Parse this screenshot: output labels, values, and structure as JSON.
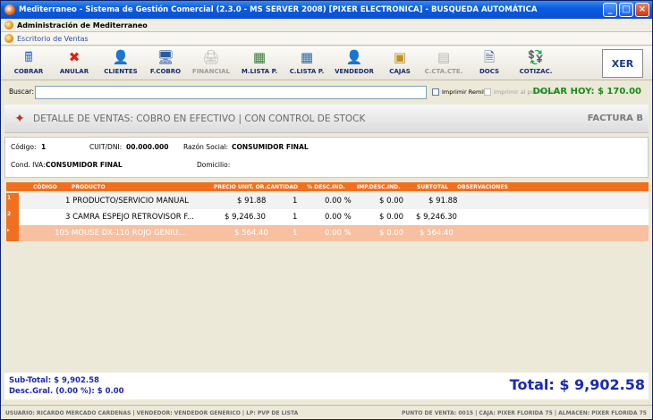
{
  "window": {
    "title": "Mediterraneo - Sistema de Gestión Comercial (2.3.0 - MS SERVER 2008) [PIXER ELECTRONICA] - BUSQUEDA AUTOMÁTICA",
    "btn_min": "_",
    "btn_max": "□",
    "btn_close": "×"
  },
  "menubar": {
    "admin": "Administración de Mediterraneo",
    "desk": "Escritorio de Ventas"
  },
  "toolbar": {
    "items": [
      {
        "label": "COBRAR",
        "icon": "cash-register-icon",
        "glyph": "🖩",
        "color": "#2a6ac0",
        "disabled": false
      },
      {
        "label": "ANULAR",
        "icon": "cancel-x-icon",
        "glyph": "✖",
        "color": "#e02010",
        "disabled": false
      },
      {
        "label": "CLIENTES",
        "icon": "person-icon",
        "glyph": "👤",
        "color": "#c06020",
        "disabled": false
      },
      {
        "label": "F.COBRO",
        "icon": "monitor-person-icon",
        "glyph": "🖥",
        "color": "#2a5aa0",
        "disabled": false
      },
      {
        "label": "FINANCIAL",
        "icon": "printer-icon",
        "glyph": "🖨",
        "color": "#707070",
        "disabled": true
      },
      {
        "label": "M.LISTA P.",
        "icon": "grid-list-icon",
        "glyph": "▦",
        "color": "#3a7a3a",
        "disabled": false
      },
      {
        "label": "C.LISTA P.",
        "icon": "grid-search-icon",
        "glyph": "▦",
        "color": "#2a6aa0",
        "disabled": false
      },
      {
        "label": "VENDEDOR",
        "icon": "salesman-icon",
        "glyph": "👤",
        "color": "#d08020",
        "disabled": false
      },
      {
        "label": "CAJAS",
        "icon": "boxes-icon",
        "glyph": "▣",
        "color": "#c09020",
        "disabled": false
      },
      {
        "label": "C.CTA.CTE.",
        "icon": "account-icon",
        "glyph": "▤",
        "color": "#707070",
        "disabled": true
      },
      {
        "label": "DOCS",
        "icon": "document-icon",
        "glyph": "🗎",
        "color": "#4a6a9a",
        "disabled": false
      },
      {
        "label": "COTIZAC.",
        "icon": "money-icon",
        "glyph": "💱",
        "color": "#3a9a3a",
        "disabled": false
      }
    ],
    "logo": "XER"
  },
  "search": {
    "label": "Buscar:",
    "value": "",
    "imprimir_remito": "Imprimir Remito",
    "imprimir_mayor": "Imprimir al por Mayor",
    "dolar": "DOLAR HOY: $ 170.00"
  },
  "header": {
    "title": "DETALLE DE VENTAS: COBRO EN EFECTIVO | CON CONTROL DE STOCK",
    "doc_type": "FACTURA B"
  },
  "client": {
    "codigo_label": "Código:",
    "codigo": "1",
    "cuit_label": "CUIT/DNI:",
    "cuit": "00.000.000",
    "razon_label": "Razón Social:",
    "razon": "CONSUMIDOR FINAL",
    "iva_label": "Cond. IVA:",
    "iva": "CONSUMIDOR FINAL",
    "domicilio_label": "Domicilio:",
    "domicilio": ""
  },
  "grid": {
    "columns": [
      "CÓDIGO",
      "PRODUCTO",
      "PRECIO UNIT. OR...",
      "CANTIDAD",
      "% DESC.IND.",
      "IMP.DESC.IND.",
      "SUBTOTAL",
      "OBSERVACIONES"
    ],
    "rows": [
      {
        "num": "1",
        "producto": "1 PRODUCTO/SERVICIO MANUAL",
        "precio": "$ 91.88",
        "cantidad": "1",
        "desc_pct": "0.00 %",
        "imp_desc": "$ 0.00",
        "subtotal": "$ 91.88"
      },
      {
        "num": "2",
        "producto": "3 CAMRA ESPEJO RETROVISOR F...",
        "precio": "$ 9,246.30",
        "cantidad": "1",
        "desc_pct": "0.00 %",
        "imp_desc": "$ 0.00",
        "subtotal": "$ 9,246.30"
      },
      {
        "num": "▸",
        "producto": "105 MOUSE DX-110 ROJO GENIU...",
        "precio": "$ 564.40",
        "cantidad": "1",
        "desc_pct": "0.00 %",
        "imp_desc": "$ 0.00",
        "subtotal": "$ 564.40"
      }
    ]
  },
  "totals": {
    "subtotal": "Sub-Total: $ 9,902.58",
    "desc": "Desc.Gral. (0.00 %): $ 0.00",
    "total": "Total: $ 9,902.58"
  },
  "status": {
    "left": "USUARIO: RICARDO MERCADO CARDENAS  |  VENDEDOR: VENDEDOR GENERICO  |  LP: PVP DE LISTA",
    "right": "PUNTO DE VENTA: 0015  |  CAJA: PIXER FLORIDA 75  |  ALMACEN: PIXER FLORIDA 75"
  }
}
